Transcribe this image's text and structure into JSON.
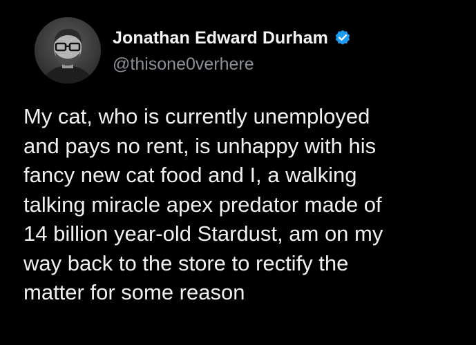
{
  "author": {
    "display_name": "Jonathan Edward Durham",
    "handle": "@thisone0verhere",
    "verified": true,
    "avatar_icon": "profile-photo-man-with-glasses",
    "verified_icon": "verified-badge-icon",
    "verified_color": "#1d9bf0"
  },
  "tweet": {
    "lines": [
      "My cat, who is currently unemployed",
      "and pays no rent, is unhappy with his",
      "fancy new cat food and I, a walking",
      "talking miracle apex predator made of",
      "14 billion year-old Stardust, am on my",
      "way back to the store to rectify the",
      "matter for some reason"
    ]
  },
  "colors": {
    "background": "#000000",
    "text": "#f0f0f0",
    "handle": "#8b9096"
  }
}
